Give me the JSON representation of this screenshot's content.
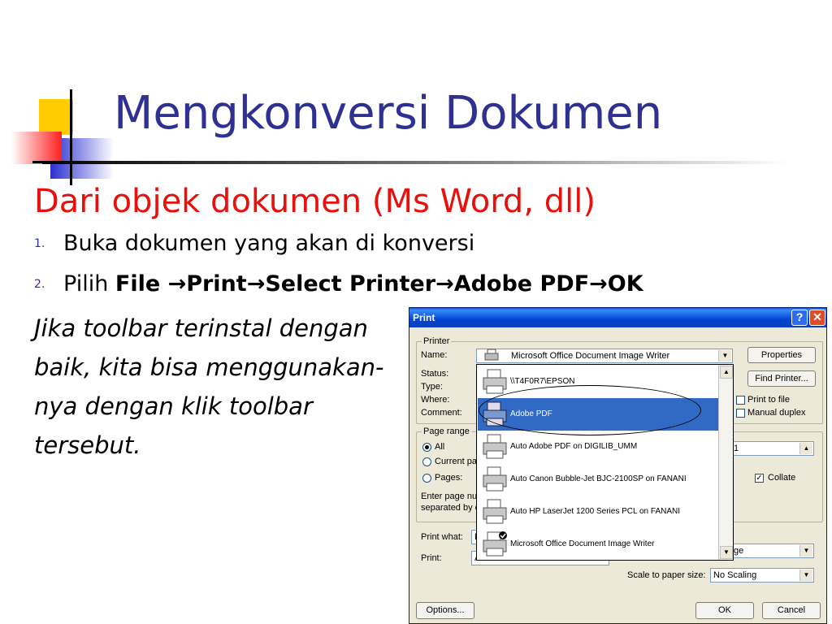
{
  "slide": {
    "title": "Mengkonversi Dokumen",
    "subtitle": "Dari objek dokumen (Ms Word, dll)",
    "steps": [
      {
        "num": "1.",
        "text": "Buka dokumen yang akan di konversi"
      },
      {
        "num": "2.",
        "prefix": "Pilih ",
        "path": [
          {
            "text": "File "
          },
          {
            "arrow": "→"
          },
          {
            "text": "Print"
          },
          {
            "arrow": "→"
          },
          {
            "text": "Select Printer"
          },
          {
            "arrow": "→"
          },
          {
            "text": "Adobe PDF"
          },
          {
            "arrow": "→"
          },
          {
            "text": "OK"
          }
        ]
      }
    ],
    "note_lines": [
      "Jika toolbar terinstal dengan",
      "baik, kita bisa menggunakan-",
      "nya dengan klik toolbar",
      "tersebut."
    ]
  },
  "dialog": {
    "title": "Print",
    "help_glyph": "?",
    "close_glyph": "✕",
    "printer_group": "Printer",
    "name_label": "Name:",
    "name_value": "Microsoft Office Document Image Writer",
    "status_label": "Status:",
    "type_label": "Type:",
    "where_label": "Where:",
    "comment_label": "Comment:",
    "properties_btn": "Properties",
    "find_printer_btn": "Find Printer...",
    "print_to_file": "Print to file",
    "manual_duplex": "Manual duplex",
    "printers": [
      {
        "name": "\\\\T4F0R7\\EPSON",
        "selected": false
      },
      {
        "name": "Adobe PDF",
        "selected": true
      },
      {
        "name": "Auto Adobe PDF on DIGILIB_UMM",
        "selected": false
      },
      {
        "name": "Auto Canon Bubble-Jet BJC-2100SP on FANANI",
        "selected": false
      },
      {
        "name": "Auto HP LaserJet 1200 Series PCL on FANANI",
        "selected": false
      },
      {
        "name": "Microsoft Office Document Image Writer",
        "selected": false,
        "default": true
      }
    ],
    "page_range_group": "Page range",
    "all_label": "All",
    "current_label": "Current pa",
    "pages_label": "Pages:",
    "enter_hint_1": "Enter page nu",
    "enter_hint_2": "separated by c",
    "copies_value": "1",
    "collate_label": "Collate",
    "print_what_label": "Print what:",
    "print_what_value": "D",
    "print_label": "Print:",
    "print_value": "A",
    "pages_per_sheet_value": "ge",
    "scale_label": "Scale to paper size:",
    "scale_value": "No Scaling",
    "options_btn": "Options...",
    "ok_btn": "OK",
    "cancel_btn": "Cancel"
  },
  "colors": {
    "title": "#2e3192",
    "subtitle": "#e8100c",
    "selection": "#316ac5"
  }
}
